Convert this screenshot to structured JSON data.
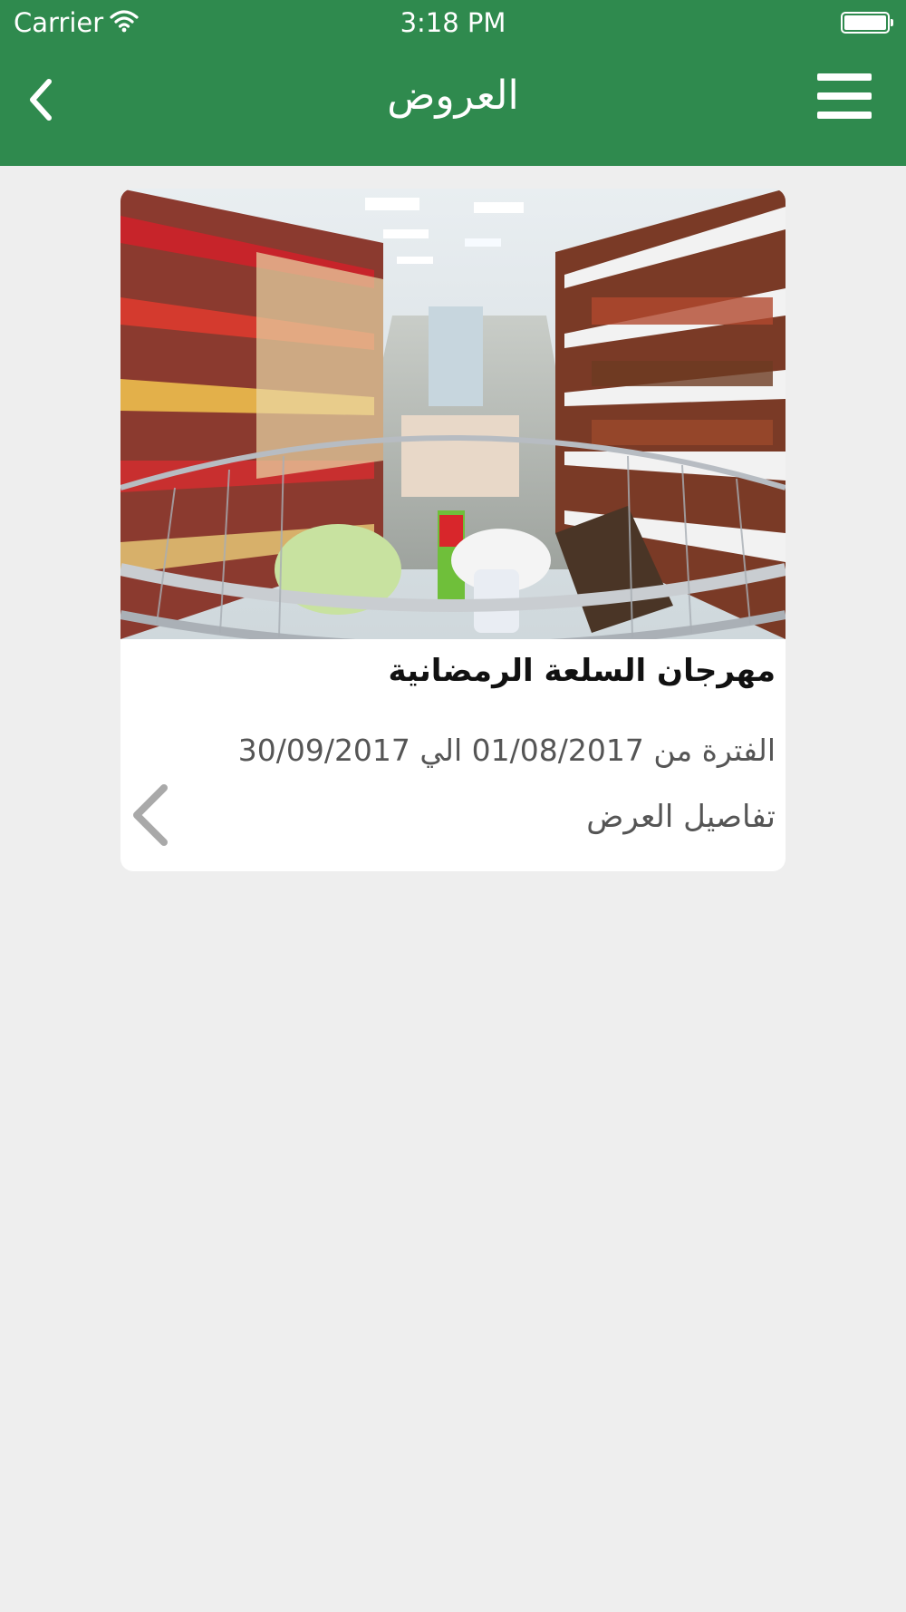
{
  "status_bar": {
    "carrier": "Carrier",
    "time": "3:18 PM",
    "wifi_icon": "wifi-icon",
    "battery_icon": "battery-icon"
  },
  "nav": {
    "title": "العروض",
    "back_icon": "chevron-left-icon",
    "menu_icon": "hamburger-menu-icon"
  },
  "colors": {
    "header_green": "#2f8a4e",
    "background": "#eeeeee",
    "card": "#ffffff"
  },
  "offers": [
    {
      "image": "supermarket-aisle-shopping-cart-photo",
      "title": "مهرجان السلعة الرمضانية",
      "period": "الفترة من 01/08/2017 الي 30/09/2017",
      "details_label": "تفاصيل العرض",
      "details_icon": "chevron-left-icon"
    }
  ]
}
